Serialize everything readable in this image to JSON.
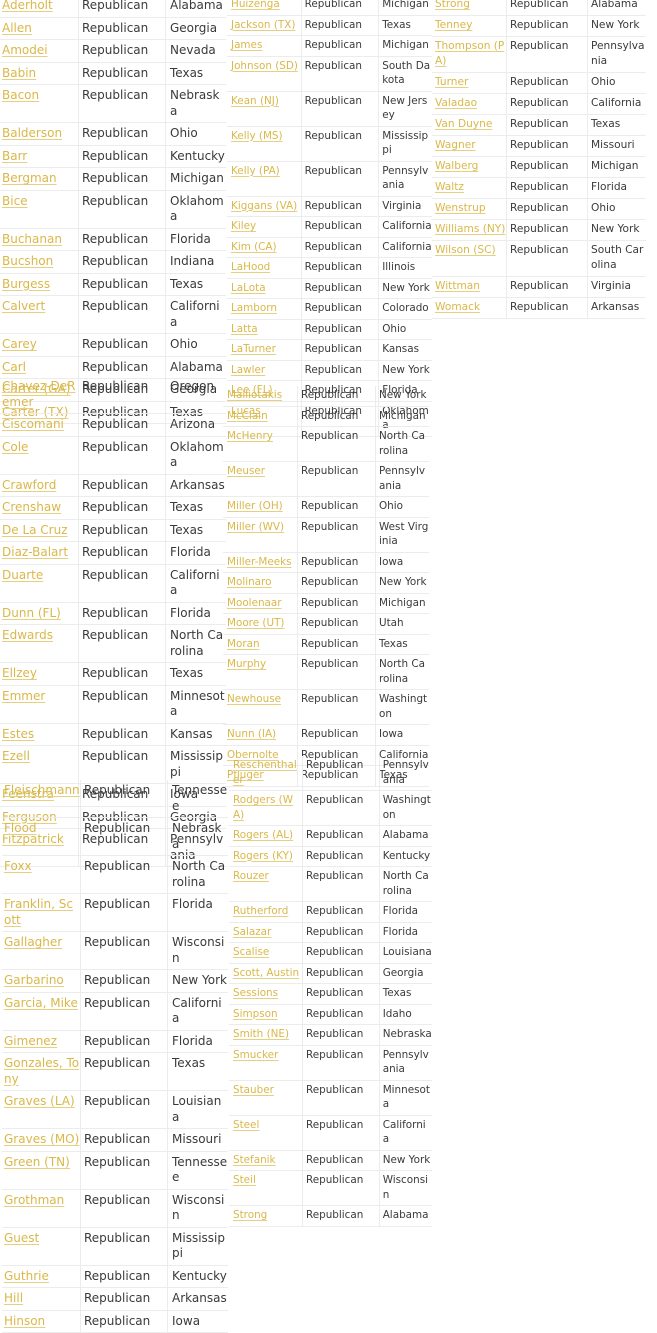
{
  "link_color": "#d9b84a",
  "border_color": "#ececec",
  "columns": [
    {
      "id": "A",
      "segments": [
        {
          "rows": [
            {
              "name": "Aderholt",
              "party": "Republican",
              "state": "Alabama"
            },
            {
              "name": "Allen",
              "party": "Republican",
              "state": "Georgia"
            },
            {
              "name": "Amodei",
              "party": "Republican",
              "state": "Nevada"
            },
            {
              "name": "Babin",
              "party": "Republican",
              "state": "Texas"
            },
            {
              "name": "Bacon",
              "party": "Republican",
              "state": "Nebraska"
            },
            {
              "name": "Balderson",
              "party": "Republican",
              "state": "Ohio"
            },
            {
              "name": "Barr",
              "party": "Republican",
              "state": "Kentucky"
            },
            {
              "name": "Bergman",
              "party": "Republican",
              "state": "Michigan"
            },
            {
              "name": "Bice",
              "party": "Republican",
              "state": "Oklahoma"
            },
            {
              "name": "Buchanan",
              "party": "Republican",
              "state": "Florida"
            },
            {
              "name": "Bucshon",
              "party": "Republican",
              "state": "Indiana"
            },
            {
              "name": "Burgess",
              "party": "Republican",
              "state": "Texas"
            },
            {
              "name": "Calvert",
              "party": "Republican",
              "state": "California"
            },
            {
              "name": "Carey",
              "party": "Republican",
              "state": "Ohio"
            },
            {
              "name": "Carl",
              "party": "Republican",
              "state": "Alabama"
            },
            {
              "name": "Carter (GA)",
              "party": "Republican",
              "state": "Georgia"
            },
            {
              "name": "Carter (TX)",
              "party": "Republican",
              "state": "Texas"
            }
          ]
        },
        {
          "rows": [
            {
              "name": "Chavez-DeRemer",
              "party": "Republican",
              "state": "Oregon"
            },
            {
              "name": "Ciscomani",
              "party": "Republican",
              "state": "Arizona"
            },
            {
              "name": "Cole",
              "party": "Republican",
              "state": "Oklahoma"
            },
            {
              "name": "Crawford",
              "party": "Republican",
              "state": "Arkansas"
            },
            {
              "name": "Crenshaw",
              "party": "Republican",
              "state": "Texas"
            },
            {
              "name": "De La Cruz",
              "party": "Republican",
              "state": "Texas"
            },
            {
              "name": "Diaz-Balart",
              "party": "Republican",
              "state": "Florida"
            },
            {
              "name": "Duarte",
              "party": "Republican",
              "state": "California"
            },
            {
              "name": "Dunn (FL)",
              "party": "Republican",
              "state": "Florida"
            },
            {
              "name": "Edwards",
              "party": "Republican",
              "state": "North Carolina"
            },
            {
              "name": "Ellzey",
              "party": "Republican",
              "state": "Texas"
            },
            {
              "name": "Emmer",
              "party": "Republican",
              "state": "Minnesota"
            },
            {
              "name": "Estes",
              "party": "Republican",
              "state": "Kansas"
            },
            {
              "name": "Ezell",
              "party": "Republican",
              "state": "Mississippi"
            },
            {
              "name": "Feenstra",
              "party": "Republican",
              "state": "Iowa"
            },
            {
              "name": "Ferguson",
              "party": "Republican",
              "state": "Georgia"
            },
            {
              "name": "Fitzpatrick",
              "party": "Republican",
              "state": "Pennsylvania"
            }
          ]
        },
        {
          "rows": [
            {
              "name": "Fleischmann",
              "party": "Republican",
              "state": "Tennessee"
            },
            {
              "name": "Flood",
              "party": "Republican",
              "state": "Nebraska"
            },
            {
              "name": "Foxx",
              "party": "Republican",
              "state": "North Carolina"
            },
            {
              "name": "Franklin, Scott",
              "party": "Republican",
              "state": "Florida"
            },
            {
              "name": "Gallagher",
              "party": "Republican",
              "state": "Wisconsin"
            },
            {
              "name": "Garbarino",
              "party": "Republican",
              "state": "New York"
            },
            {
              "name": "Garcia, Mike",
              "party": "Republican",
              "state": "California"
            },
            {
              "name": "Gimenez",
              "party": "Republican",
              "state": "Florida"
            },
            {
              "name": "Gonzales, Tony",
              "party": "Republican",
              "state": "Texas"
            },
            {
              "name": "Graves (LA)",
              "party": "Republican",
              "state": "Louisiana"
            },
            {
              "name": "Graves (MO)",
              "party": "Republican",
              "state": "Missouri"
            },
            {
              "name": "Green (TN)",
              "party": "Republican",
              "state": "Tennessee"
            },
            {
              "name": "Grothman",
              "party": "Republican",
              "state": "Wisconsin"
            },
            {
              "name": "Guest",
              "party": "Republican",
              "state": "Mississippi"
            },
            {
              "name": "Guthrie",
              "party": "Republican",
              "state": "Kentucky"
            },
            {
              "name": "Hill",
              "party": "Republican",
              "state": "Arkansas"
            },
            {
              "name": "Hinson",
              "party": "Republican",
              "state": "Iowa"
            }
          ]
        }
      ]
    },
    {
      "id": "B",
      "segments": [
        {
          "rows": [
            {
              "name": "Huizenga",
              "party": "Republican",
              "state": "Michigan"
            },
            {
              "name": "Jackson (TX)",
              "party": "Republican",
              "state": "Texas"
            },
            {
              "name": "James",
              "party": "Republican",
              "state": "Michigan"
            },
            {
              "name": "Johnson (SD)",
              "party": "Republican",
              "state": "South Dakota"
            },
            {
              "name": "Kean (NJ)",
              "party": "Republican",
              "state": "New Jersey"
            },
            {
              "name": "Kelly (MS)",
              "party": "Republican",
              "state": "Mississippi"
            },
            {
              "name": "Kelly (PA)",
              "party": "Republican",
              "state": "Pennsylvania"
            },
            {
              "name": "Kiggans (VA)",
              "party": "Republican",
              "state": "Virginia"
            },
            {
              "name": "Kiley",
              "party": "Republican",
              "state": "California"
            },
            {
              "name": "Kim (CA)",
              "party": "Republican",
              "state": "California"
            },
            {
              "name": "LaHood",
              "party": "Republican",
              "state": "Illinois"
            },
            {
              "name": "LaLota",
              "party": "Republican",
              "state": "New York"
            },
            {
              "name": "Lamborn",
              "party": "Republican",
              "state": "Colorado"
            },
            {
              "name": "Latta",
              "party": "Republican",
              "state": "Ohio"
            },
            {
              "name": "LaTurner",
              "party": "Republican",
              "state": "Kansas"
            },
            {
              "name": "Lawler",
              "party": "Republican",
              "state": "New York"
            },
            {
              "name": "Lee (FL)",
              "party": "Republican",
              "state": "Florida"
            },
            {
              "name": "Lucas",
              "party": "Republican",
              "state": "Oklahoma"
            }
          ]
        },
        {
          "rows": [
            {
              "name": "Malliotakis",
              "party": "Republican",
              "state": "New York"
            },
            {
              "name": "McClain",
              "party": "Republican",
              "state": "Michigan"
            },
            {
              "name": "McHenry",
              "party": "Republican",
              "state": "North Carolina"
            },
            {
              "name": "Meuser",
              "party": "Republican",
              "state": "Pennsylvania"
            },
            {
              "name": "Miller (OH)",
              "party": "Republican",
              "state": "Ohio"
            },
            {
              "name": "Miller (WV)",
              "party": "Republican",
              "state": "West Virginia"
            },
            {
              "name": "Miller-Meeks",
              "party": "Republican",
              "state": "Iowa"
            },
            {
              "name": "Molinaro",
              "party": "Republican",
              "state": "New York"
            },
            {
              "name": "Moolenaar",
              "party": "Republican",
              "state": "Michigan"
            },
            {
              "name": "Moore (UT)",
              "party": "Republican",
              "state": "Utah"
            },
            {
              "name": "Moran",
              "party": "Republican",
              "state": "Texas"
            },
            {
              "name": "Murphy",
              "party": "Republican",
              "state": "North Carolina"
            },
            {
              "name": "Newhouse",
              "party": "Republican",
              "state": "Washington"
            },
            {
              "name": "Nunn (IA)",
              "party": "Republican",
              "state": "Iowa"
            },
            {
              "name": "Obernolte",
              "party": "Republican",
              "state": "California"
            },
            {
              "name": "Pfluger",
              "party": "Republican",
              "state": "Texas"
            }
          ]
        },
        {
          "rows": [
            {
              "name": "Reschenthaler",
              "party": "Republican",
              "state": "Pennsylvania"
            },
            {
              "name": "Rodgers (WA)",
              "party": "Republican",
              "state": "Washington"
            },
            {
              "name": "Rogers (AL)",
              "party": "Republican",
              "state": "Alabama"
            },
            {
              "name": "Rogers (KY)",
              "party": "Republican",
              "state": "Kentucky"
            },
            {
              "name": "Rouzer",
              "party": "Republican",
              "state": "North Carolina"
            },
            {
              "name": "Rutherford",
              "party": "Republican",
              "state": "Florida"
            },
            {
              "name": "Salazar",
              "party": "Republican",
              "state": "Florida"
            },
            {
              "name": "Scalise",
              "party": "Republican",
              "state": "Louisiana"
            },
            {
              "name": "Scott, Austin",
              "party": "Republican",
              "state": "Georgia"
            },
            {
              "name": "Sessions",
              "party": "Republican",
              "state": "Texas"
            },
            {
              "name": "Simpson",
              "party": "Republican",
              "state": "Idaho"
            },
            {
              "name": "Smith (NE)",
              "party": "Republican",
              "state": "Nebraska"
            },
            {
              "name": "Smucker",
              "party": "Republican",
              "state": "Pennsylvania"
            },
            {
              "name": "Stauber",
              "party": "Republican",
              "state": "Minnesota"
            },
            {
              "name": "Steel",
              "party": "Republican",
              "state": "California"
            },
            {
              "name": "Stefanik",
              "party": "Republican",
              "state": "New York"
            },
            {
              "name": "Steil",
              "party": "Republican",
              "state": "Wisconsin"
            },
            {
              "name": "Strong",
              "party": "Republican",
              "state": "Alabama"
            }
          ]
        }
      ]
    },
    {
      "id": "C",
      "segments": [
        {
          "rows": [
            {
              "name": "Strong",
              "party": "Republican",
              "state": "Alabama"
            },
            {
              "name": "Tenney",
              "party": "Republican",
              "state": "New York"
            },
            {
              "name": "Thompson (PA)",
              "party": "Republican",
              "state": "Pennsylvania"
            },
            {
              "name": "Turner",
              "party": "Republican",
              "state": "Ohio"
            },
            {
              "name": "Valadao",
              "party": "Republican",
              "state": "California"
            },
            {
              "name": "Van Duyne",
              "party": "Republican",
              "state": "Texas"
            },
            {
              "name": "Wagner",
              "party": "Republican",
              "state": "Missouri"
            },
            {
              "name": "Walberg",
              "party": "Republican",
              "state": "Michigan"
            },
            {
              "name": "Waltz",
              "party": "Republican",
              "state": "Florida"
            },
            {
              "name": "Wenstrup",
              "party": "Republican",
              "state": "Ohio"
            },
            {
              "name": "Williams (NY)",
              "party": "Republican",
              "state": "New York"
            },
            {
              "name": "Wilson (SC)",
              "party": "Republican",
              "state": "South Carolina"
            },
            {
              "name": "Wittman",
              "party": "Republican",
              "state": "Virginia"
            },
            {
              "name": "Womack",
              "party": "Republican",
              "state": "Arkansas"
            }
          ]
        }
      ]
    }
  ]
}
